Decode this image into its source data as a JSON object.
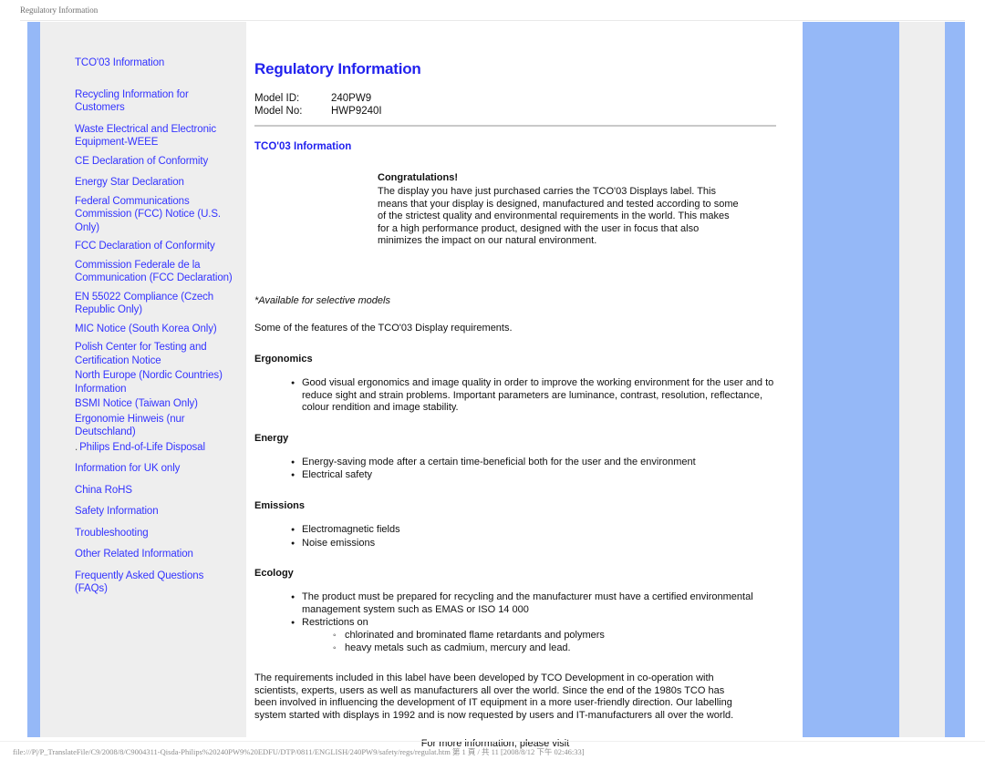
{
  "print": {
    "header_title": "Regulatory Information",
    "footer_text": "file:///P|/P_TranslateFile/C9/2008/8/C9004311-Qisda-Philips%20240PW9%20EDFU/DTP/0811/ENGLISH/240PW9/safety/regs/regulat.htm 第 1 頁 / 共 11 [2008/8/12 下午 02:46:33]"
  },
  "colors": {
    "link_blue": "#3333ff",
    "title_blue": "#2222ee",
    "panel_blue": "#95b8f7",
    "sidebar_gray": "#eeeeee",
    "rule_gray": "#c9c9c9"
  },
  "sidebar": {
    "items": [
      {
        "label": "TCO'03 Information"
      },
      {
        "label": "Recycling Information for Customers"
      },
      {
        "label": "Waste Electrical and Electronic Equipment-WEEE"
      },
      {
        "label": "CE Declaration of Conformity"
      },
      {
        "label": "Energy Star Declaration"
      },
      {
        "label": "Federal Communications Commission (FCC) Notice (U.S. Only)"
      },
      {
        "label": "FCC Declaration of Conformity"
      },
      {
        "label": "Commission Federale de la Communication (FCC Declaration)"
      },
      {
        "label": "EN 55022 Compliance (Czech Republic Only)"
      },
      {
        "label": "MIC Notice (South Korea Only)"
      },
      {
        "label": "Polish Center for Testing and Certification Notice"
      },
      {
        "label": "North Europe (Nordic Countries) Information"
      },
      {
        "label": "BSMI Notice (Taiwan Only)"
      },
      {
        "label": "Ergonomie Hinweis (nur Deutschland)"
      },
      {
        "label": "Philips End-of-Life Disposal"
      },
      {
        "label": "Information for UK only"
      },
      {
        "label": "China RoHS"
      },
      {
        "label": "Safety Information"
      },
      {
        "label": "Troubleshooting"
      },
      {
        "label": "Other Related Information"
      },
      {
        "label": "Frequently Asked Questions (FAQs)"
      }
    ]
  },
  "main": {
    "page_title": "Regulatory Information",
    "model": {
      "id_label": "Model ID:",
      "id_value": "240PW9",
      "no_label": "Model No:",
      "no_value": "HWP9240I"
    },
    "section_title": "TCO'03 Information",
    "congratulations": {
      "heading": "Congratulations!",
      "body": "The display you have just purchased carries the TCO'03 Displays label. This means that your display is designed, manufactured and tested according to some of the strictest quality and environmental requirements in the world. This makes for a high performance product, designed with the user in focus that also minimizes the impact on our natural environment."
    },
    "availability_note": "*Available for selective models",
    "features_lead": "Some of the features of the TCO'03 Display requirements.",
    "sections": [
      {
        "heading": "Ergonomics",
        "items": [
          "Good visual ergonomics and image quality in order to improve the working environment for the user and to reduce sight and strain problems. Important parameters are luminance, contrast, resolution, reflectance, colour rendition and image stability."
        ]
      },
      {
        "heading": "Energy",
        "items": [
          "Energy-saving mode after a certain time-beneficial both for the user and the environment",
          "Electrical safety"
        ]
      },
      {
        "heading": "Emissions",
        "items": [
          "Electromagnetic fields",
          "Noise emissions"
        ]
      },
      {
        "heading": "Ecology",
        "items": [
          "The product must be prepared for recycling and the manufacturer must have a certified environmental management system such as EMAS or ISO 14 000",
          "Restrictions on"
        ],
        "sub_items": [
          "chlorinated and brominated flame retardants and polymers",
          "heavy metals such as cadmium, mercury and lead."
        ]
      }
    ],
    "closing_paragraph": "The requirements included in this label have been developed by TCO Development in co-operation with scientists, experts, users as well as manufacturers all over the world. Since the end of the 1980s TCO has been involved in influencing the development of IT equipment in a more user-friendly direction. Our labelling system started with displays in 1992 and is now requested by users and IT-manufacturers all over the world.",
    "visit_text": "For more information, please visit"
  }
}
